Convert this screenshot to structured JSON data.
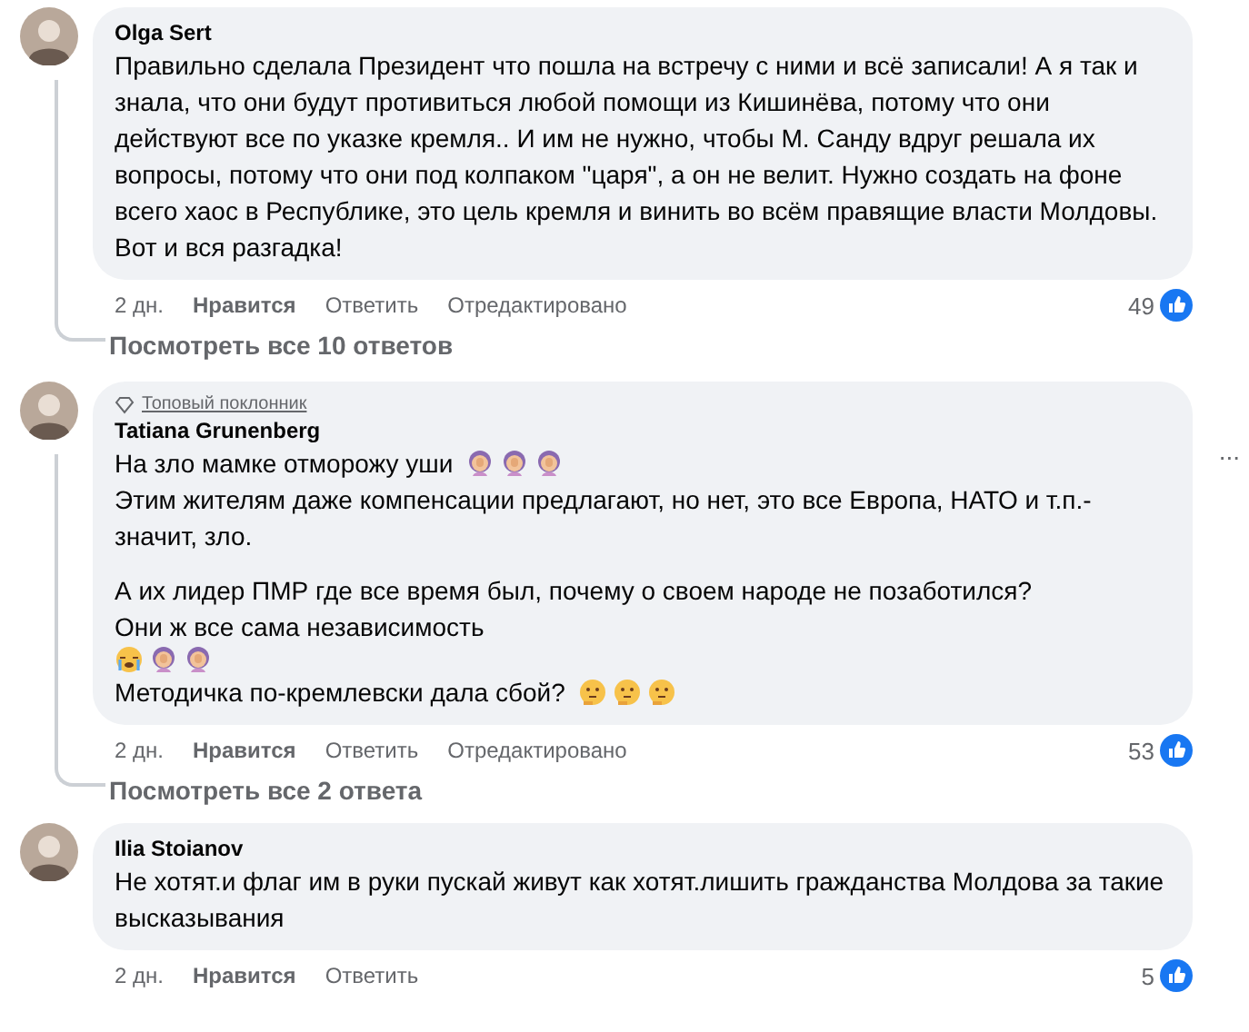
{
  "comments": [
    {
      "author": "Olga Sert",
      "lines": [
        {
          "text": "Правильно сделала Президент что пошла на встречу с ними и всё записали! А я так и знала, что они будут противиться любой помощи из Кишинёва, потому что они действуют все по указке кремля.. И им не нужно, чтобы М. Санду вдруг решала их вопросы, потому что они под колпаком \"царя\", а он не велит. Нужно создать на фоне всего хаос в Республике, это цель кремля и винить во всём правящие власти Молдовы. Вот и вся разгадка!"
        }
      ],
      "time": "2 дн.",
      "like": "Нравится",
      "reply": "Ответить",
      "edited": "Отредактировано",
      "likes": "49",
      "view_replies": "Посмотреть все 10 ответов"
    },
    {
      "badge": "Топовый поклонник",
      "author": "Tatiana Grunenberg",
      "lines": [
        {
          "text": "На зло мамке отморожу уши",
          "emoji": [
            {
              "kind": "facepalm"
            },
            {
              "kind": "facepalm"
            },
            {
              "kind": "facepalm"
            }
          ]
        },
        {
          "text": "Этим жителям даже компенсации предлагают, но нет, это все Европа, НАТО и т.п.- значит, зло."
        },
        {
          "kind": "gap"
        },
        {
          "text": "А их лидер ПМР где все время был, почему о своем народе не позаботился?"
        },
        {
          "text": "Они ж все сама независимость"
        },
        {
          "emoji": [
            {
              "kind": "crying"
            },
            {
              "kind": "facepalm"
            },
            {
              "kind": "facepalm"
            }
          ]
        },
        {
          "text": "Методичка по-кремлевски дала сбой?",
          "emoji": [
            {
              "kind": "thinking"
            },
            {
              "kind": "thinking"
            },
            {
              "kind": "thinking"
            }
          ]
        }
      ],
      "time": "2 дн.",
      "like": "Нравится",
      "reply": "Ответить",
      "edited": "Отредактировано",
      "likes": "53",
      "view_replies": "Посмотреть все 2 ответа",
      "more": "..."
    },
    {
      "author": "Ilia Stoianov",
      "lines": [
        {
          "text": "Не хотят.и флаг им в руки пускай живут как хотят.лишить гражданства Молдова за такие высказывания"
        }
      ],
      "time": "2 дн.",
      "like": "Нравится",
      "reply": "Ответить",
      "likes": "5"
    }
  ]
}
